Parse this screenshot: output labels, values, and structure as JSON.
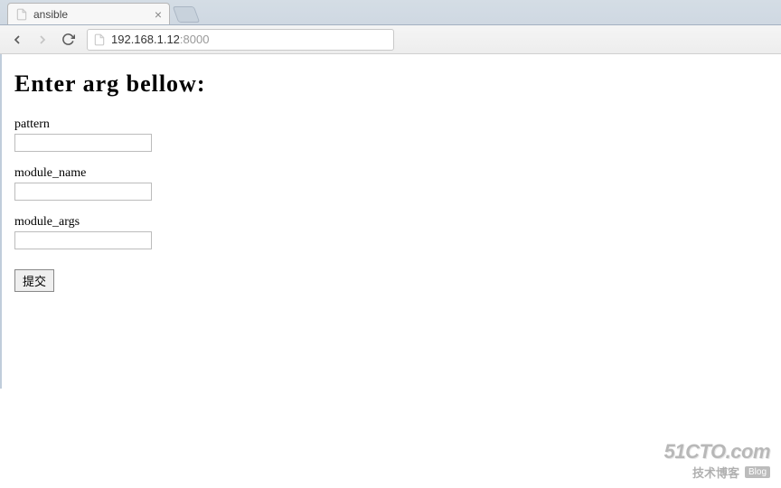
{
  "browser": {
    "tab_title": "ansible",
    "url_host": "192.168.1.12",
    "url_port": ":8000"
  },
  "page": {
    "heading": "Enter arg bellow:",
    "fields": {
      "pattern": {
        "label": "pattern",
        "value": ""
      },
      "module_name": {
        "label": "module_name",
        "value": ""
      },
      "module_args": {
        "label": "module_args",
        "value": ""
      }
    },
    "submit_label": "提交"
  },
  "watermark": {
    "line1": "51CTO.com",
    "line2": "技术博客",
    "badge": "Blog"
  }
}
